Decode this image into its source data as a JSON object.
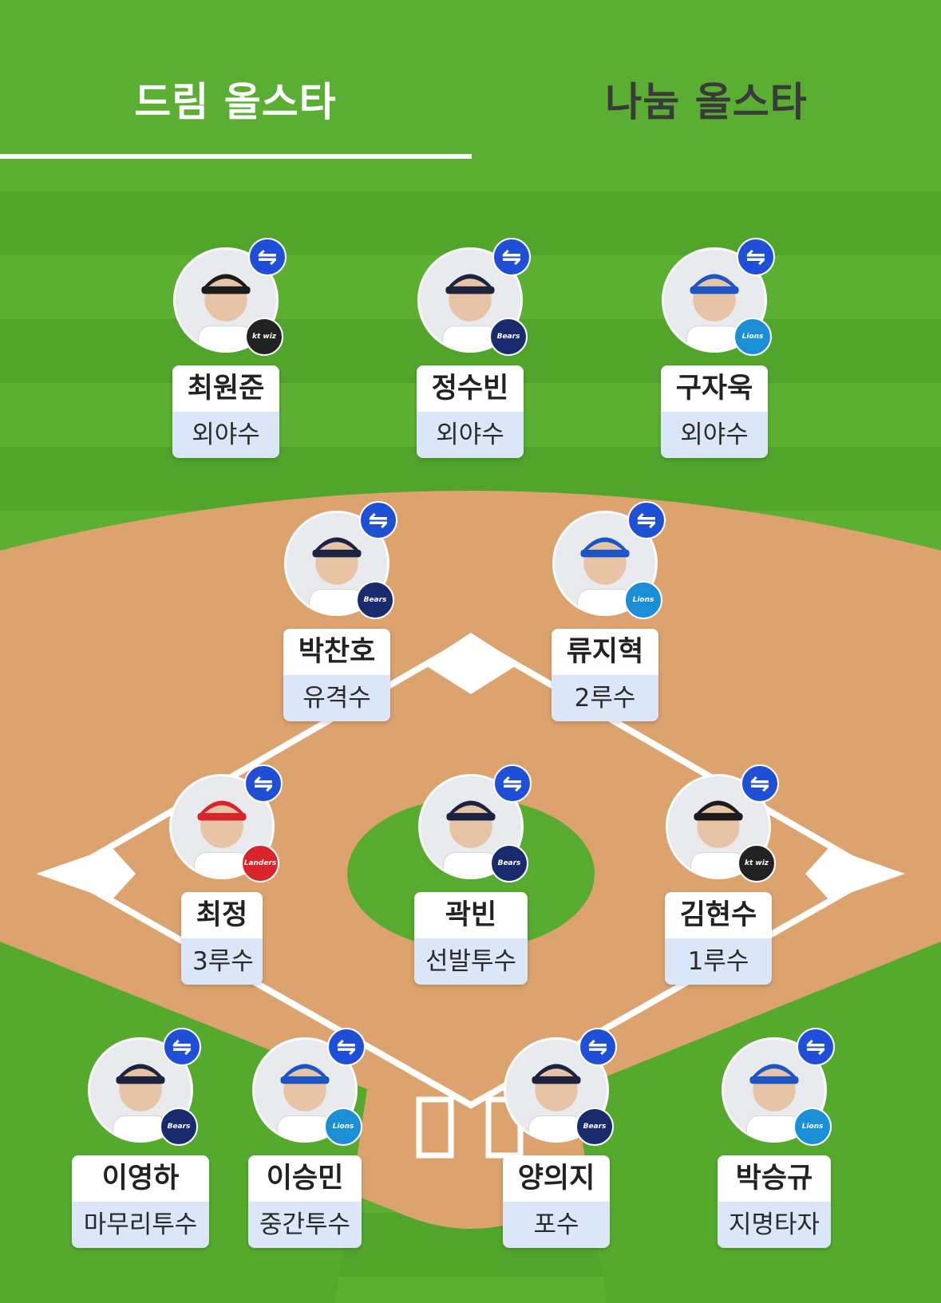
{
  "tabs": [
    {
      "label": "드림 올스타",
      "active": true
    },
    {
      "label": "나눔 올스타",
      "active": false
    }
  ],
  "swap_icon": "⇋",
  "colors": {
    "grass": "#56a92e",
    "dirt": "#dca36f",
    "swap_button": "#1f4fd6",
    "position_bg": "#dbe7f8"
  },
  "players": [
    {
      "name": "최원준",
      "position": "외야수",
      "team": "kt wiz",
      "team_icon": "ktwiz-logo-icon"
    },
    {
      "name": "정수빈",
      "position": "외야수",
      "team": "Bears",
      "team_icon": "bears-logo-icon"
    },
    {
      "name": "구자욱",
      "position": "외야수",
      "team": "Lions",
      "team_icon": "lions-logo-icon"
    },
    {
      "name": "박찬호",
      "position": "유격수",
      "team": "Bears",
      "team_icon": "bears-logo-icon"
    },
    {
      "name": "류지혁",
      "position": "2루수",
      "team": "Lions",
      "team_icon": "lions-logo-icon"
    },
    {
      "name": "최정",
      "position": "3루수",
      "team": "Landers",
      "team_icon": "landers-logo-icon"
    },
    {
      "name": "곽빈",
      "position": "선발투수",
      "team": "Bears",
      "team_icon": "bears-logo-icon"
    },
    {
      "name": "김현수",
      "position": "1루수",
      "team": "kt wiz",
      "team_icon": "ktwiz-logo-icon"
    },
    {
      "name": "이영하",
      "position": "마무리투수",
      "team": "Bears",
      "team_icon": "bears-logo-icon"
    },
    {
      "name": "이승민",
      "position": "중간투수",
      "team": "Lions",
      "team_icon": "lions-logo-icon"
    },
    {
      "name": "양의지",
      "position": "포수",
      "team": "Bears",
      "team_icon": "bears-logo-icon"
    },
    {
      "name": "박승규",
      "position": "지명타자",
      "team": "Lions",
      "team_icon": "lions-logo-icon"
    }
  ]
}
